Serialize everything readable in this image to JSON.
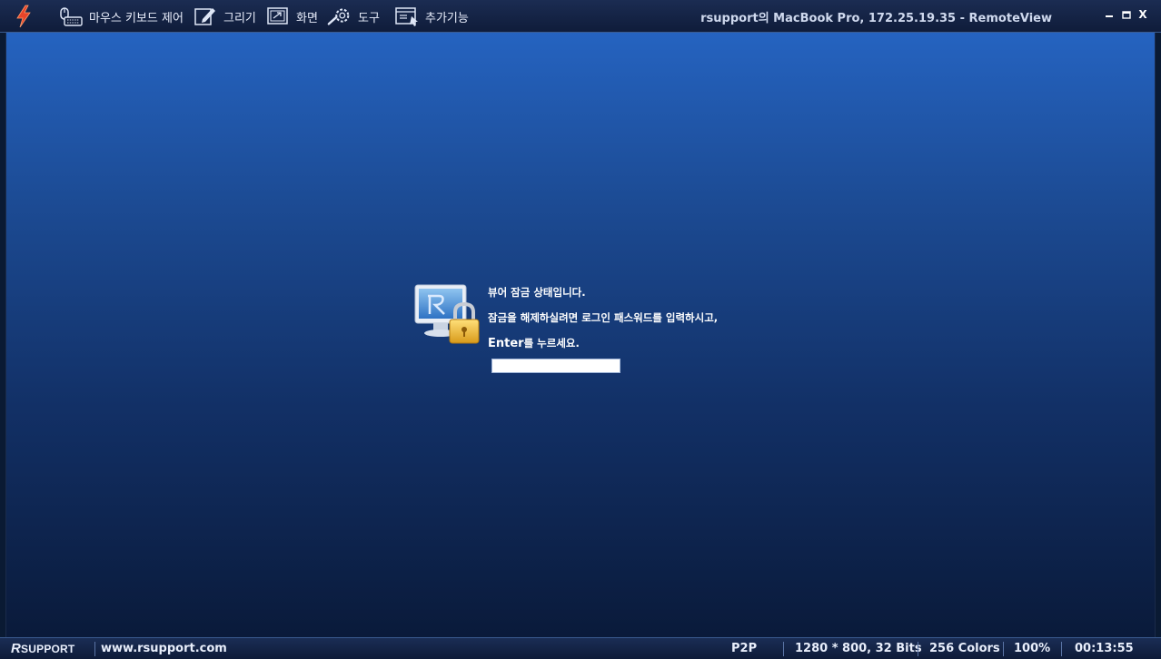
{
  "toolbar": {
    "items": [
      {
        "label": "마우스 키보드 제어",
        "icon": "mouse-keyboard-icon"
      },
      {
        "label": "그리기",
        "icon": "draw-icon"
      },
      {
        "label": "화면",
        "icon": "screen-icon"
      },
      {
        "label": "도구",
        "icon": "tools-gear-icon"
      },
      {
        "label": "추가기능",
        "icon": "extra-features-icon"
      }
    ],
    "app_icon": "lightning-icon"
  },
  "window": {
    "title": "rsupport의 MacBook Pro, 172.25.19.35 - RemoteView",
    "controls": {
      "minimize": "–",
      "maximize": "□",
      "close": "X"
    }
  },
  "lock_screen": {
    "line1": "뷰어 잠금 상태입니다.",
    "line2": "잠금을 해제하실려면 로그인 패스워드를 입력하시고,",
    "line3_enter": "Enter",
    "line3_rest": "를 누르세요.",
    "password_value": ""
  },
  "statusbar": {
    "brand_r": "R",
    "brand_rest": "SUPPORT",
    "website": "www.rsupport.com",
    "connection": "P2P",
    "resolution": "1280 * 800, 32 Bits",
    "colors": "256 Colors",
    "zoom": "100%",
    "elapsed": "00:13:55"
  },
  "colors": {
    "accent": "#2563c0",
    "bar": "#13244a",
    "lightning": "#e8452a"
  }
}
